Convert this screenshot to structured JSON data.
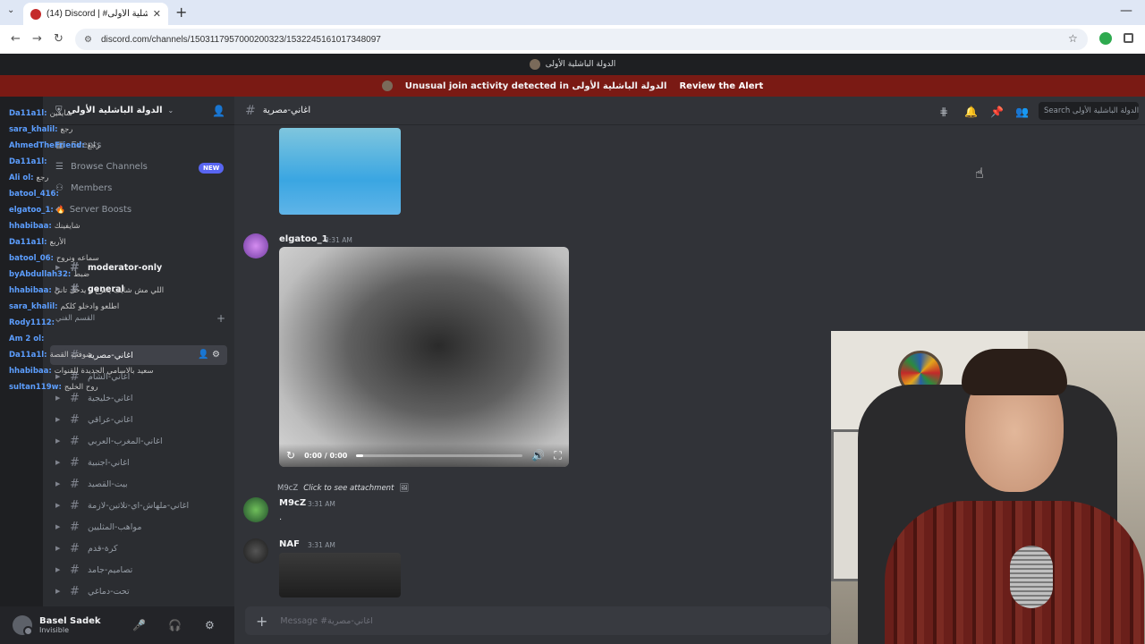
{
  "browser": {
    "tab_title": "(14) Discord | #اغاني-مصرية | الدولة الباشلية الأولى",
    "url": "discord.com/channels/1503117957000200323/1532245161017348097"
  },
  "server": {
    "topbar_name": "الدولة الباشلية الأولى",
    "name": "الدولة الباشلية الأولى",
    "alert_text": "Unusual join activity detected in الدولة الباشلية الأولى",
    "alert_link": "Review the Alert"
  },
  "sidebar": {
    "menu": [
      {
        "label": "Events"
      },
      {
        "label": "Browse Channels",
        "badge": "NEW"
      },
      {
        "label": "Members"
      },
      {
        "label": "Server Boosts"
      }
    ],
    "channels_top": [
      {
        "label": "moderator-only"
      },
      {
        "label": "general"
      }
    ],
    "category": "القسم الفني",
    "channels": [
      {
        "label": "اغاني-مصرية",
        "active": true
      },
      {
        "label": "اغاني-الشام"
      },
      {
        "label": "اغاني-خليجية"
      },
      {
        "label": "اغاني-عراقي"
      },
      {
        "label": "اغاني-المغرب-العربي"
      },
      {
        "label": "اغاني-اجنبية"
      },
      {
        "label": "بيت-القصيد"
      },
      {
        "label": "اغاني-ملهاش-اي-تلاتين-لازمة"
      },
      {
        "label": "مواهب-المثليين"
      },
      {
        "label": "كرة-قدم"
      },
      {
        "label": "تصاميم-جامد"
      },
      {
        "label": "تحت-دماغي"
      }
    ]
  },
  "user": {
    "name": "Basel Sadek",
    "status": "Invisible"
  },
  "channel": {
    "name": "اغاني-مصرية",
    "search_placeholder": "Search الدولة الباشلية الأولى"
  },
  "messages": [
    {
      "author": "elgatoo_1",
      "time": "3:31 AM",
      "video_time": "0:00 / 0:00",
      "video_progress": 0.04
    },
    {
      "reply_author": "M9cZ",
      "reply_text": "Click to see attachment",
      "author": "M9cZ",
      "time": "3:31 AM",
      "body": "."
    },
    {
      "author": "NAF",
      "time": "3:31 AM"
    }
  ],
  "composer": {
    "placeholder": "Message #اغاني-مصرية"
  },
  "chat_overlay": [
    {
      "name": "Da11a1l:",
      "text": "شايفين"
    },
    {
      "name": "sara_khalil:",
      "text": "رجع"
    },
    {
      "name": "AhmedTheFriend:",
      "text": "رجع"
    },
    {
      "name": "Da11a1l:",
      "text": ""
    },
    {
      "name": "Ali ol:",
      "text": "رجع"
    },
    {
      "name": "batool_416:",
      "text": ""
    },
    {
      "name": "elgatoo_1:",
      "text": "🔥"
    },
    {
      "name": "hhabibaa:",
      "text": "شايفينك"
    },
    {
      "name": "Da11a1l:",
      "text": "الأربع"
    },
    {
      "name": "batool_06:",
      "text": "سماعه ونروح"
    },
    {
      "name": "byAbdullah32:",
      "text": "ضبط"
    },
    {
      "name": "hhabibaa:",
      "text": "اللي مش شايف يخرج و يدخل تاني"
    },
    {
      "name": "sara_khalil:",
      "text": "اطلعو وادخلو كلكم"
    },
    {
      "name": "Rody1112:",
      "text": ""
    },
    {
      "name": "Am 2 ol:",
      "text": ""
    },
    {
      "name": "Da11a1l:",
      "text": "شوفت القصة"
    },
    {
      "name": "hhabibaa:",
      "text": "سعيد بالاسامي الجديدة للقنوات"
    },
    {
      "name": "sultan119w:",
      "text": "روح الخليج"
    }
  ]
}
